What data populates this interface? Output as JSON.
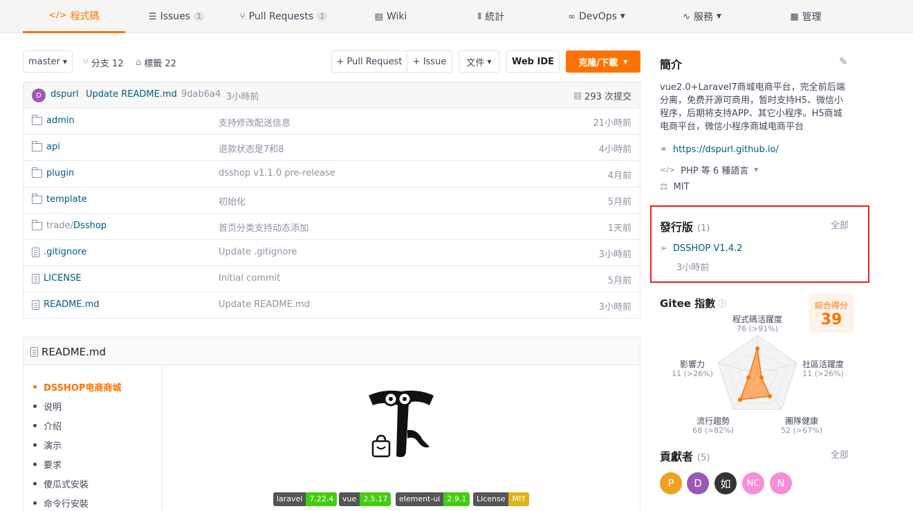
{
  "tabs": [
    {
      "label": "程式碼",
      "icon": "code-icon",
      "count": ""
    },
    {
      "label": "Issues",
      "icon": "issue-icon",
      "count": "1"
    },
    {
      "label": "Pull Requests",
      "icon": "pull-request-icon",
      "count": "1"
    },
    {
      "label": "Wiki",
      "icon": "wiki-icon",
      "count": ""
    },
    {
      "label": "統計",
      "icon": "stats-icon",
      "count": ""
    },
    {
      "label": "DevOps",
      "icon": "devops-icon",
      "count": ""
    },
    {
      "label": "服務",
      "icon": "service-icon",
      "count": ""
    },
    {
      "label": "管理",
      "icon": "manage-icon",
      "count": ""
    }
  ],
  "toolbar": {
    "branch": "master",
    "branches": "分支 12",
    "tags": "標籤 22",
    "pull_request": "+ Pull Request",
    "issue": "+ Issue",
    "file": "文件",
    "web_ide": "Web IDE",
    "clone": "克隆/下載"
  },
  "commit": {
    "avatar": "D",
    "author": "dspurl",
    "message": "Update README.md",
    "hash": "9dab6a4",
    "time": "3小時前",
    "total": "293 次提交"
  },
  "files": [
    {
      "name": "admin",
      "type": "folder",
      "message": "支持修改配送信息",
      "time": "21小時前"
    },
    {
      "name": "api",
      "type": "folder",
      "message": "退款状态是7和8",
      "time": "4小時前"
    },
    {
      "name": "plugin",
      "type": "folder",
      "message": "dsshop v1.1.0 pre-release",
      "time": "4月前"
    },
    {
      "name": "template",
      "type": "folder",
      "message": "初始化",
      "time": "5月前"
    },
    {
      "name_prefix": "trade/",
      "name": "Dsshop",
      "type": "folder",
      "message": "首页分类支持动态添加",
      "time": "1天前"
    },
    {
      "name": ".gitignore",
      "type": "file",
      "message": "Update .gitignore",
      "time": "3小時前"
    },
    {
      "name": "LICENSE",
      "type": "file",
      "message": "Initial commit",
      "time": "5月前"
    },
    {
      "name": "README.md",
      "type": "file",
      "message": "Update README.md",
      "time": "3小時前"
    }
  ],
  "readme": {
    "title": "README.md",
    "toc": [
      "DSSHOP电商商城",
      "说明",
      "介绍",
      "演示",
      "要求",
      "傻瓜式安裝",
      "命令行安裝"
    ],
    "badges": [
      {
        "l": "laravel",
        "r": "7.22.4",
        "color": "#4c1"
      },
      {
        "l": "vue",
        "r": "2.5.17",
        "color": "#4c1"
      },
      {
        "l": "element-ui",
        "r": "2.9.1",
        "color": "#4c1"
      },
      {
        "l": "License",
        "r": "MIT",
        "color": "#dfb317"
      }
    ]
  },
  "sidebar": {
    "intro_title": "簡介",
    "intro_text": "vue2.0+Laravel7商城电商平台，完全前后端分离，免费开源可商用，暂时支持H5、微信小程序，后期将支持APP、其它小程序。H5商城电商平台，微信小程序商城电商平台",
    "url": "https://dspurl.github.io/",
    "languages": "PHP 等 6 種語言",
    "license": "MIT",
    "releases_title": "發行版",
    "releases_count": "(1)",
    "releases_all": "全部",
    "release_name": "DSSHOP V1.4.2",
    "release_time": "3小時前",
    "gitee_title": "Gitee 指數",
    "score_label": "綜合得分",
    "score_value": "39",
    "radar": [
      {
        "name": "程式碼活躍度",
        "value": "76 (>91%)"
      },
      {
        "name": "社區活躍度",
        "value": "11 (>26%)"
      },
      {
        "name": "團隊健康",
        "value": "52 (>67%)"
      },
      {
        "name": "流行趨勢",
        "value": "68 (>82%)"
      },
      {
        "name": "影響力",
        "value": "11 (>26%)"
      }
    ],
    "contrib_title": "貢獻者",
    "contrib_count": "(5)",
    "contrib_all": "全部",
    "contributors": [
      {
        "initial": "P",
        "color": "#f0a020"
      },
      {
        "initial": "D",
        "color": "#9b59b6"
      },
      {
        "initial": "如",
        "color": "#333333"
      },
      {
        "initial": "NC",
        "color": "#f48fd8"
      },
      {
        "initial": "N",
        "color": "#f48fd8"
      }
    ]
  }
}
